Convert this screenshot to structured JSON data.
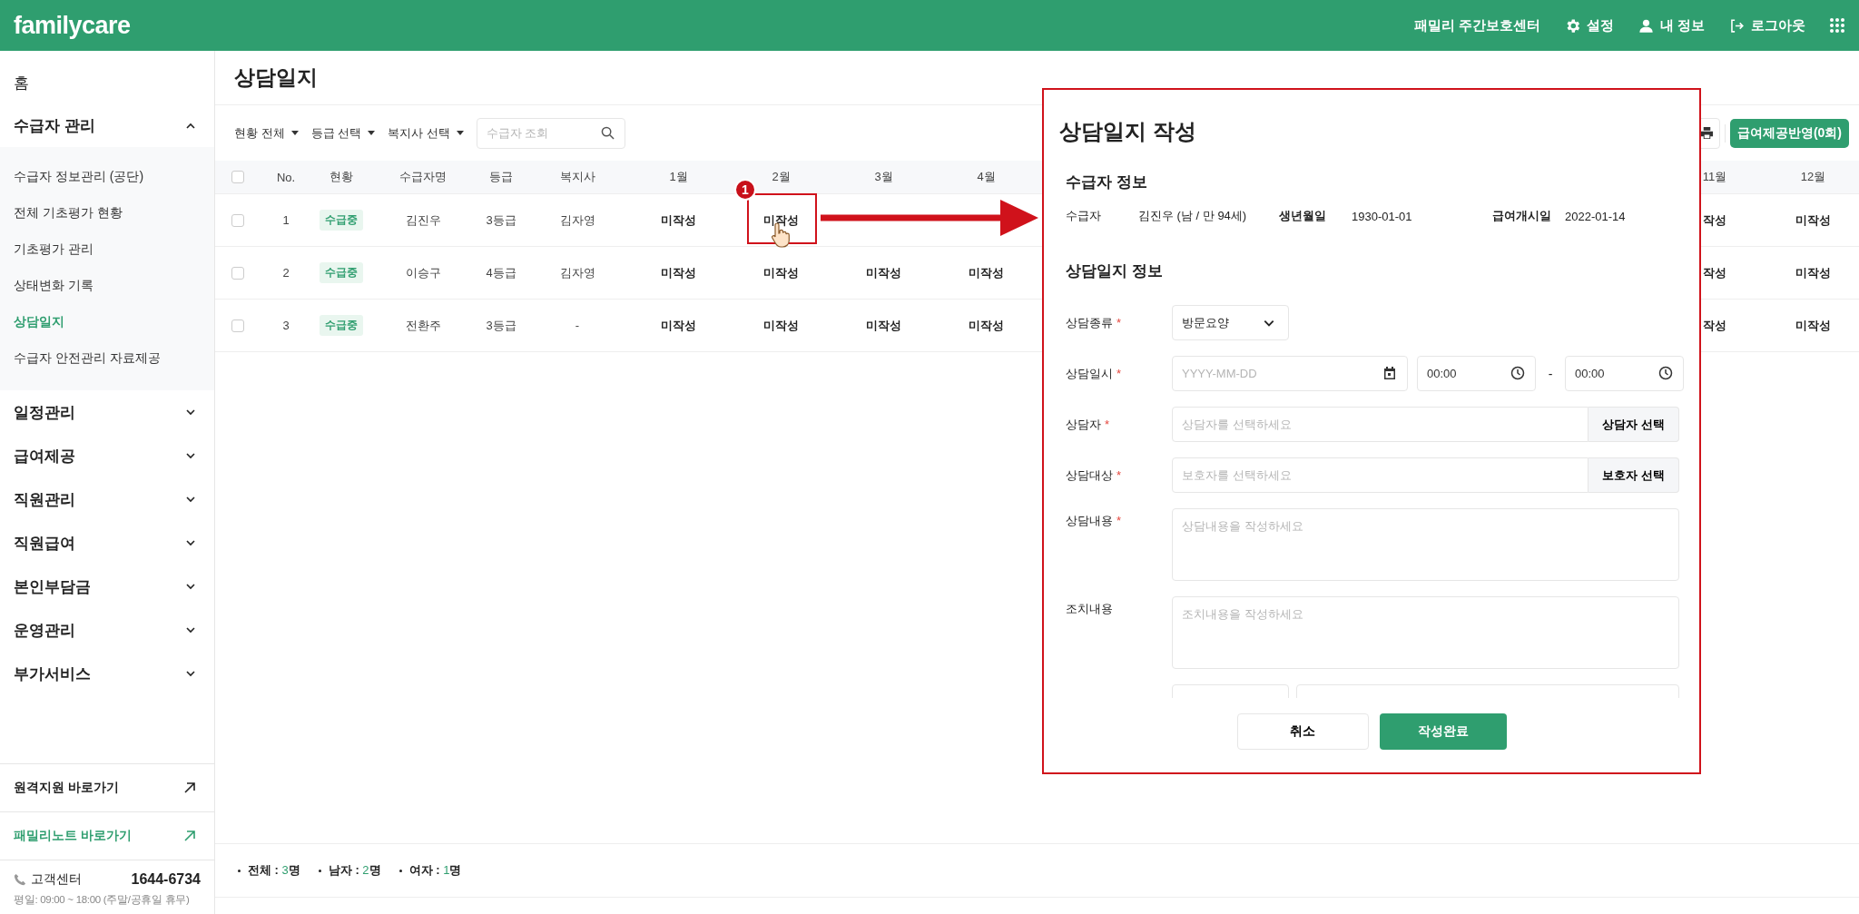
{
  "header": {
    "logo": "familycare",
    "center_name": "패밀리 주간보호센터",
    "menu": [
      {
        "kind": "settings",
        "label": "설정"
      },
      {
        "kind": "profile",
        "label": "내 정보"
      },
      {
        "kind": "logout",
        "label": "로그아웃"
      }
    ]
  },
  "sidebar": {
    "home": "홈",
    "groups": [
      {
        "label": "수급자 관리",
        "expanded": true,
        "children": [
          {
            "label": "수급자 정보관리 (공단)",
            "selected": false
          },
          {
            "label": "전체 기초평가 현황",
            "selected": false
          },
          {
            "label": "기초평가 관리",
            "selected": false
          },
          {
            "label": "상태변화 기록",
            "selected": false
          },
          {
            "label": "상담일지",
            "selected": true
          },
          {
            "label": "수급자 안전관리 자료제공",
            "selected": false
          }
        ]
      },
      {
        "label": "일정관리",
        "expanded": false
      },
      {
        "label": "급여제공",
        "expanded": false
      },
      {
        "label": "직원관리",
        "expanded": false
      },
      {
        "label": "직원급여",
        "expanded": false
      },
      {
        "label": "본인부담금",
        "expanded": false
      },
      {
        "label": "운영관리",
        "expanded": false
      },
      {
        "label": "부가서비스",
        "expanded": false
      }
    ],
    "links": [
      {
        "label": "원격지원 바로가기",
        "kind": "default"
      },
      {
        "label": "패밀리노트 바로가기",
        "kind": "primary"
      }
    ],
    "support": {
      "label": "고객센터",
      "phone": "1644-6734",
      "hours": "평일: 09:00 ~ 18:00 (주말/공휴일 휴무)"
    }
  },
  "page": {
    "title": "상담일지",
    "filters": [
      "현황 전체",
      "등급 선택",
      "복지사 선택"
    ],
    "search": {
      "placeholder": "수급자 조회"
    },
    "apply_button": "급여제공반영(0회)"
  },
  "table": {
    "header_checked": false,
    "columns": [
      "No.",
      "현황",
      "수급자명",
      "등급",
      "복지사",
      "1월",
      "2월",
      "3월",
      "4월"
    ],
    "right_columns": [
      "11월",
      "12월"
    ],
    "rows": [
      {
        "checked": false,
        "no": "1",
        "status": "수급중",
        "name": "김진우",
        "grade": "3등급",
        "worker": "김자영",
        "months": [
          "미작성",
          "미작성"
        ],
        "right_months": [
          "작성",
          "미작성"
        ]
      },
      {
        "checked": false,
        "no": "2",
        "status": "수급중",
        "name": "이승구",
        "grade": "4등급",
        "worker": "김자영",
        "months": [
          "미작성",
          "미작성",
          "미작성",
          "미작성"
        ],
        "right_months": [
          "작성",
          "미작성"
        ]
      },
      {
        "checked": false,
        "no": "3",
        "status": "수급중",
        "name": "전환주",
        "grade": "3등급",
        "worker": "-",
        "months": [
          "미작성",
          "미작성",
          "미작성",
          "미작성"
        ],
        "right_months": [
          "작성",
          "미작성"
        ]
      }
    ]
  },
  "summary": [
    {
      "label": "전체 :",
      "count": "3",
      "unit": "명"
    },
    {
      "label": "남자 :",
      "count": "2",
      "unit": "명"
    },
    {
      "label": "여자 :",
      "count": "1",
      "unit": "명"
    }
  ],
  "annotation": {
    "step": "1"
  },
  "modal": {
    "title": "상담일지 작성",
    "recipient_section": "수급자 정보",
    "info": [
      {
        "kind": "plain",
        "label": "수급자",
        "value": "김진우 (남 / 만 94세)"
      },
      {
        "kind": "bold",
        "label": "생년월일",
        "value": "1930-01-01"
      },
      {
        "kind": "bold",
        "label": "급여개시일",
        "value": "2022-01-14"
      }
    ],
    "form_section": "상담일지 정보",
    "required_mark": "*",
    "fields": [
      {
        "kind": "select",
        "label": "상담종류",
        "required": true,
        "value": "방문요양"
      },
      {
        "kind": "datetime",
        "label": "상담일시",
        "required": true,
        "date_placeholder": "YYYY-MM-DD",
        "start_time": "00:00",
        "separator": "-",
        "end_time": "00:00"
      },
      {
        "kind": "picker",
        "label": "상담자",
        "required": true,
        "placeholder": "상담자를 선택하세요",
        "button": "상담자 선택"
      },
      {
        "kind": "picker",
        "label": "상담대상",
        "required": true,
        "placeholder": "보호자를 선택하세요",
        "button": "보호자 선택"
      },
      {
        "kind": "textarea",
        "label": "상담내용",
        "required": true,
        "placeholder": "상담내용을 작성하세요"
      },
      {
        "kind": "textarea",
        "label": "조치내용",
        "required": false,
        "placeholder": "조치내용을 작성하세요"
      },
      {
        "kind": "cut"
      }
    ],
    "cancel": "취소",
    "submit": "작성완료"
  }
}
